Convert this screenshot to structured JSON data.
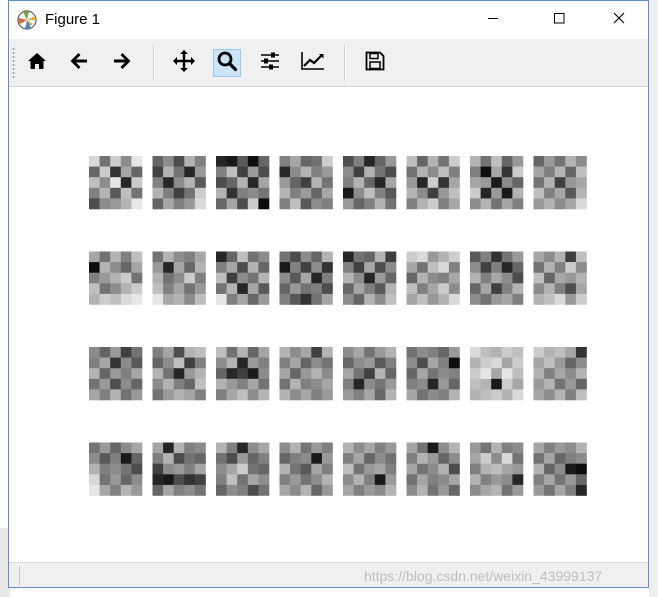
{
  "window": {
    "title": "Figure 1",
    "app_icon": "matplotlib-icon",
    "controls": [
      {
        "name": "minimize",
        "icon": "minimize-icon"
      },
      {
        "name": "maximize",
        "icon": "maximize-icon"
      },
      {
        "name": "close",
        "icon": "close-icon"
      }
    ]
  },
  "toolbar": {
    "buttons": [
      {
        "name": "home",
        "icon": "home-icon",
        "active": false
      },
      {
        "name": "back",
        "icon": "arrow-left-icon",
        "active": false
      },
      {
        "name": "forward",
        "icon": "arrow-right-icon",
        "active": false
      },
      {
        "name": "pan",
        "icon": "move-icon",
        "active": false
      },
      {
        "name": "zoom",
        "icon": "magnifier-icon",
        "active": true
      },
      {
        "name": "configure-subplots",
        "icon": "sliders-icon",
        "active": false
      },
      {
        "name": "edit-axes",
        "icon": "line-chart-icon",
        "active": false
      },
      {
        "name": "save",
        "icon": "floppy-disk-icon",
        "active": false
      }
    ]
  },
  "figure": {
    "rows": 4,
    "cols": 8,
    "cell_grid": 5,
    "colormap": "gray_r",
    "tiles": [
      [
        [
          0.15,
          0.55,
          0.2,
          0.45,
          0.1
        ],
        [
          0.6,
          0.2,
          0.8,
          0.35,
          0.6
        ],
        [
          0.25,
          0.45,
          0.1,
          0.85,
          0.2
        ],
        [
          0.5,
          0.3,
          0.65,
          0.25,
          0.55
        ],
        [
          0.7,
          0.45,
          0.4,
          0.3,
          0.1
        ]
      ],
      [
        [
          0.6,
          0.45,
          0.7,
          0.3,
          0.5
        ],
        [
          0.75,
          0.3,
          0.55,
          0.85,
          0.4
        ],
        [
          0.5,
          0.85,
          0.45,
          0.3,
          0.65
        ],
        [
          0.3,
          0.5,
          0.75,
          0.55,
          0.2
        ],
        [
          0.6,
          0.35,
          0.5,
          0.4,
          0.15
        ]
      ],
      [
        [
          0.85,
          0.9,
          0.65,
          0.95,
          0.6
        ],
        [
          0.5,
          0.25,
          0.75,
          0.4,
          0.7
        ],
        [
          0.7,
          0.6,
          0.3,
          0.85,
          0.35
        ],
        [
          0.3,
          0.8,
          0.5,
          0.45,
          0.55
        ],
        [
          0.6,
          0.35,
          0.7,
          0.2,
          0.95
        ]
      ],
      [
        [
          0.5,
          0.35,
          0.6,
          0.55,
          0.2
        ],
        [
          0.85,
          0.45,
          0.3,
          0.5,
          0.4
        ],
        [
          0.4,
          0.6,
          0.75,
          0.3,
          0.55
        ],
        [
          0.3,
          0.5,
          0.4,
          0.6,
          0.35
        ],
        [
          0.5,
          0.25,
          0.65,
          0.45,
          0.5
        ]
      ],
      [
        [
          0.7,
          0.5,
          0.85,
          0.6,
          0.4
        ],
        [
          0.45,
          0.75,
          0.3,
          0.55,
          0.7
        ],
        [
          0.5,
          0.3,
          0.6,
          0.85,
          0.35
        ],
        [
          0.9,
          0.45,
          0.25,
          0.5,
          0.65
        ],
        [
          0.4,
          0.6,
          0.5,
          0.3,
          0.55
        ]
      ],
      [
        [
          0.25,
          0.6,
          0.3,
          0.55,
          0.2
        ],
        [
          0.55,
          0.3,
          0.45,
          0.25,
          0.5
        ],
        [
          0.4,
          0.85,
          0.2,
          0.8,
          0.35
        ],
        [
          0.3,
          0.45,
          0.75,
          0.4,
          0.25
        ],
        [
          0.5,
          0.3,
          0.2,
          0.5,
          0.35
        ]
      ],
      [
        [
          0.3,
          0.55,
          0.25,
          0.6,
          0.4
        ],
        [
          0.5,
          0.95,
          0.35,
          0.8,
          0.2
        ],
        [
          0.35,
          0.4,
          0.9,
          0.45,
          0.6
        ],
        [
          0.2,
          0.85,
          0.4,
          0.9,
          0.3
        ],
        [
          0.45,
          0.3,
          0.55,
          0.35,
          0.5
        ]
      ],
      [
        [
          0.6,
          0.4,
          0.55,
          0.3,
          0.45
        ],
        [
          0.35,
          0.5,
          0.3,
          0.6,
          0.25
        ],
        [
          0.55,
          0.3,
          0.75,
          0.4,
          0.35
        ],
        [
          0.25,
          0.5,
          0.35,
          0.65,
          0.3
        ],
        [
          0.4,
          0.3,
          0.45,
          0.35,
          0.15
        ]
      ],
      [
        [
          0.35,
          0.55,
          0.3,
          0.5,
          0.25
        ],
        [
          0.95,
          0.3,
          0.45,
          0.6,
          0.35
        ],
        [
          0.5,
          0.4,
          0.3,
          0.2,
          0.55
        ],
        [
          0.25,
          0.55,
          0.45,
          0.3,
          0.2
        ],
        [
          0.3,
          0.2,
          0.25,
          0.15,
          0.1
        ]
      ],
      [
        [
          0.55,
          0.3,
          0.45,
          0.5,
          0.35
        ],
        [
          0.4,
          0.85,
          0.35,
          0.6,
          0.3
        ],
        [
          0.3,
          0.55,
          0.45,
          0.2,
          0.5
        ],
        [
          0.25,
          0.5,
          0.35,
          0.55,
          0.4
        ],
        [
          0.1,
          0.35,
          0.3,
          0.45,
          0.25
        ]
      ],
      [
        [
          0.85,
          0.6,
          0.25,
          0.55,
          0.45
        ],
        [
          0.5,
          0.35,
          0.7,
          0.3,
          0.6
        ],
        [
          0.25,
          0.75,
          0.45,
          0.55,
          0.3
        ],
        [
          0.55,
          0.3,
          0.85,
          0.35,
          0.65
        ],
        [
          0.1,
          0.5,
          0.35,
          0.6,
          0.4
        ]
      ],
      [
        [
          0.55,
          0.7,
          0.45,
          0.6,
          0.3
        ],
        [
          0.9,
          0.5,
          0.75,
          0.45,
          0.8
        ],
        [
          0.45,
          0.65,
          0.35,
          0.85,
          0.5
        ],
        [
          0.6,
          0.4,
          0.55,
          0.5,
          0.7
        ],
        [
          0.5,
          0.65,
          0.8,
          0.55,
          0.35
        ]
      ],
      [
        [
          0.85,
          0.55,
          0.6,
          0.3,
          0.75
        ],
        [
          0.5,
          0.75,
          0.35,
          0.7,
          0.45
        ],
        [
          0.3,
          0.45,
          0.85,
          0.4,
          0.6
        ],
        [
          0.6,
          0.35,
          0.5,
          0.65,
          0.3
        ],
        [
          0.45,
          0.6,
          0.3,
          0.45,
          0.25
        ]
      ],
      [
        [
          0.2,
          0.15,
          0.4,
          0.3,
          0.2
        ],
        [
          0.35,
          0.55,
          0.25,
          0.15,
          0.5
        ],
        [
          0.6,
          0.3,
          0.45,
          0.5,
          0.35
        ],
        [
          0.25,
          0.5,
          0.35,
          0.2,
          0.45
        ],
        [
          0.35,
          0.25,
          0.4,
          0.3,
          0.15
        ]
      ],
      [
        [
          0.65,
          0.5,
          0.8,
          0.55,
          0.4
        ],
        [
          0.45,
          0.75,
          0.5,
          0.85,
          0.6
        ],
        [
          0.3,
          0.5,
          0.35,
          0.45,
          0.7
        ],
        [
          0.6,
          0.35,
          0.75,
          0.5,
          0.3
        ],
        [
          0.45,
          0.55,
          0.4,
          0.35,
          0.5
        ]
      ],
      [
        [
          0.35,
          0.45,
          0.3,
          0.75,
          0.25
        ],
        [
          0.55,
          0.3,
          0.5,
          0.2,
          0.45
        ],
        [
          0.25,
          0.6,
          0.35,
          0.4,
          0.3
        ],
        [
          0.45,
          0.3,
          0.5,
          0.7,
          0.35
        ],
        [
          0.3,
          0.25,
          0.15,
          0.4,
          0.2
        ]
      ],
      [
        [
          0.45,
          0.6,
          0.4,
          0.75,
          0.55
        ],
        [
          0.5,
          0.35,
          0.8,
          0.45,
          0.65
        ],
        [
          0.3,
          0.6,
          0.4,
          0.5,
          0.35
        ],
        [
          0.55,
          0.4,
          0.7,
          0.45,
          0.6
        ],
        [
          0.35,
          0.5,
          0.3,
          0.55,
          0.4
        ]
      ],
      [
        [
          0.5,
          0.35,
          0.7,
          0.3,
          0.25
        ],
        [
          0.6,
          0.45,
          0.25,
          0.75,
          0.5
        ],
        [
          0.3,
          0.55,
          0.85,
          0.4,
          0.3
        ],
        [
          0.45,
          0.3,
          0.5,
          0.6,
          0.25
        ],
        [
          0.55,
          0.4,
          0.3,
          0.35,
          0.5
        ]
      ],
      [
        [
          0.25,
          0.55,
          0.3,
          0.6,
          0.35
        ],
        [
          0.45,
          0.3,
          0.85,
          0.4,
          0.5
        ],
        [
          0.6,
          0.85,
          0.75,
          0.9,
          0.45
        ],
        [
          0.3,
          0.4,
          0.5,
          0.35,
          0.55
        ],
        [
          0.5,
          0.35,
          0.25,
          0.45,
          0.3
        ]
      ],
      [
        [
          0.3,
          0.45,
          0.35,
          0.75,
          0.3
        ],
        [
          0.5,
          0.35,
          0.6,
          0.45,
          0.55
        ],
        [
          0.35,
          0.6,
          0.4,
          0.3,
          0.45
        ],
        [
          0.55,
          0.3,
          0.5,
          0.45,
          0.35
        ],
        [
          0.3,
          0.45,
          0.35,
          0.5,
          0.4
        ]
      ],
      [
        [
          0.45,
          0.35,
          0.55,
          0.4,
          0.3
        ],
        [
          0.6,
          0.45,
          0.4,
          0.65,
          0.5
        ],
        [
          0.35,
          0.55,
          0.75,
          0.3,
          0.6
        ],
        [
          0.5,
          0.85,
          0.45,
          0.55,
          0.4
        ],
        [
          0.4,
          0.5,
          0.35,
          0.6,
          0.3
        ]
      ],
      [
        [
          0.55,
          0.45,
          0.5,
          0.6,
          0.4
        ],
        [
          0.45,
          0.7,
          0.35,
          0.5,
          0.95
        ],
        [
          0.6,
          0.35,
          0.55,
          0.45,
          0.5
        ],
        [
          0.5,
          0.45,
          0.85,
          0.4,
          0.6
        ],
        [
          0.35,
          0.55,
          0.45,
          0.5,
          0.3
        ]
      ],
      [
        [
          0.15,
          0.25,
          0.3,
          0.2,
          0.25
        ],
        [
          0.3,
          0.2,
          0.15,
          0.35,
          0.2
        ],
        [
          0.2,
          0.1,
          0.35,
          0.1,
          0.25
        ],
        [
          0.25,
          0.3,
          0.9,
          0.2,
          0.35
        ],
        [
          0.3,
          0.25,
          0.2,
          0.3,
          0.15
        ]
      ],
      [
        [
          0.2,
          0.3,
          0.25,
          0.35,
          0.8
        ],
        [
          0.35,
          0.25,
          0.4,
          0.6,
          0.45
        ],
        [
          0.3,
          0.5,
          0.35,
          0.45,
          0.3
        ],
        [
          0.4,
          0.3,
          0.55,
          0.4,
          0.6
        ],
        [
          0.35,
          0.45,
          0.3,
          0.5,
          0.25
        ]
      ],
      [
        [
          0.55,
          0.4,
          0.6,
          0.45,
          0.35
        ],
        [
          0.45,
          0.65,
          0.5,
          0.9,
          0.6
        ],
        [
          0.3,
          0.5,
          0.45,
          0.55,
          0.7
        ],
        [
          0.15,
          0.55,
          0.4,
          0.6,
          0.45
        ],
        [
          0.1,
          0.35,
          0.5,
          0.3,
          0.4
        ]
      ],
      [
        [
          0.35,
          0.85,
          0.3,
          0.5,
          0.45
        ],
        [
          0.5,
          0.3,
          0.7,
          0.55,
          0.6
        ],
        [
          0.75,
          0.45,
          0.4,
          0.5,
          0.35
        ],
        [
          0.85,
          0.9,
          0.7,
          0.8,
          0.75
        ],
        [
          0.6,
          0.35,
          0.5,
          0.45,
          0.55
        ]
      ],
      [
        [
          0.3,
          0.5,
          0.85,
          0.45,
          0.35
        ],
        [
          0.55,
          0.7,
          0.4,
          0.6,
          0.5
        ],
        [
          0.45,
          0.35,
          0.2,
          0.55,
          0.6
        ],
        [
          0.5,
          0.25,
          0.55,
          0.35,
          0.45
        ],
        [
          0.6,
          0.45,
          0.5,
          0.7,
          0.55
        ]
      ],
      [
        [
          0.45,
          0.3,
          0.55,
          0.4,
          0.5
        ],
        [
          0.6,
          0.5,
          0.45,
          0.9,
          0.4
        ],
        [
          0.3,
          0.55,
          0.65,
          0.35,
          0.5
        ],
        [
          0.5,
          0.4,
          0.55,
          0.45,
          0.3
        ],
        [
          0.35,
          0.45,
          0.3,
          0.6,
          0.4
        ]
      ],
      [
        [
          0.3,
          0.45,
          0.35,
          0.5,
          0.4
        ],
        [
          0.5,
          0.35,
          0.6,
          0.45,
          0.55
        ],
        [
          0.25,
          0.55,
          0.4,
          0.35,
          0.5
        ],
        [
          0.45,
          0.3,
          0.5,
          0.9,
          0.4
        ],
        [
          0.35,
          0.5,
          0.4,
          0.45,
          0.3
        ]
      ],
      [
        [
          0.35,
          0.55,
          0.9,
          0.45,
          0.3
        ],
        [
          0.5,
          0.3,
          0.4,
          0.6,
          0.45
        ],
        [
          0.35,
          0.55,
          0.45,
          0.3,
          0.7
        ],
        [
          0.55,
          0.35,
          0.5,
          0.45,
          0.35
        ],
        [
          0.45,
          0.3,
          0.55,
          0.4,
          0.6
        ]
      ],
      [
        [
          0.4,
          0.55,
          0.3,
          0.5,
          0.45
        ],
        [
          0.35,
          0.2,
          0.45,
          0.15,
          0.55
        ],
        [
          0.5,
          0.3,
          0.25,
          0.35,
          0.4
        ],
        [
          0.3,
          0.5,
          0.4,
          0.45,
          0.85
        ],
        [
          0.45,
          0.35,
          0.3,
          0.55,
          0.4
        ]
      ],
      [
        [
          0.35,
          0.5,
          0.4,
          0.45,
          0.3
        ],
        [
          0.55,
          0.35,
          0.6,
          0.5,
          0.45
        ],
        [
          0.3,
          0.6,
          0.45,
          0.9,
          0.95
        ],
        [
          0.5,
          0.35,
          0.55,
          0.4,
          0.6
        ],
        [
          0.4,
          0.55,
          0.35,
          0.5,
          0.85
        ]
      ]
    ]
  },
  "statusbar": {
    "message": ""
  },
  "watermark": "https://blog.csdn.net/weixin_43999137"
}
